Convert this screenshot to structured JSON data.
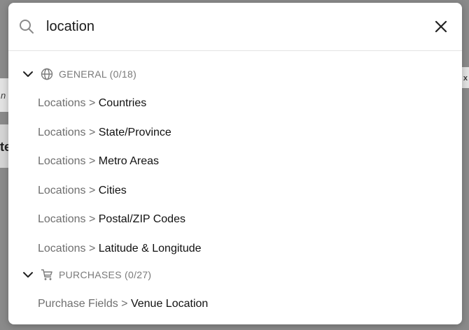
{
  "search": {
    "query": "location"
  },
  "groups": [
    {
      "label": "GENERAL (0/18)",
      "icon": "globe-icon",
      "items": [
        {
          "path": "Locations",
          "leaf": "Countries"
        },
        {
          "path": "Locations",
          "leaf": "State/Province"
        },
        {
          "path": "Locations",
          "leaf": "Metro Areas"
        },
        {
          "path": "Locations",
          "leaf": "Cities"
        },
        {
          "path": "Locations",
          "leaf": "Postal/ZIP Codes"
        },
        {
          "path": "Locations",
          "leaf": "Latitude & Longitude"
        }
      ]
    },
    {
      "label": "PURCHASES (0/27)",
      "icon": "cart-icon",
      "items": [
        {
          "path": "Purchase Fields",
          "leaf": "Venue Location"
        }
      ]
    }
  ],
  "separator": ">",
  "background": {
    "text_a": "n",
    "text_b": "te",
    "text_c": "x"
  },
  "colors": {
    "overlay": "#8a8a8a",
    "path_text": "#6f6f6f",
    "leaf_text": "#111111",
    "group_text": "#7a7a7a"
  }
}
